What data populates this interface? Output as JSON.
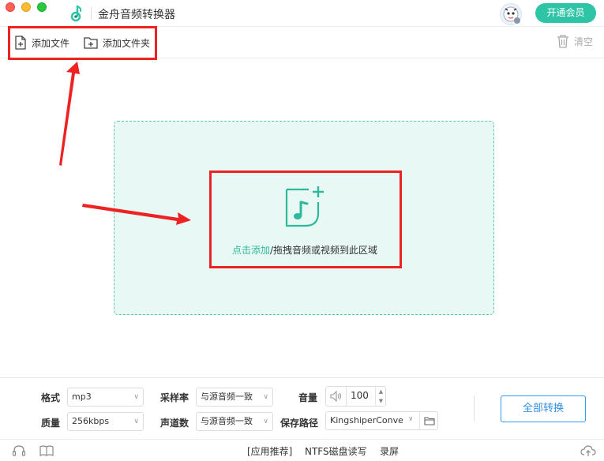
{
  "window": {
    "title": "金舟音频转换器"
  },
  "header": {
    "vip_label": "开通会员"
  },
  "toolbar": {
    "add_file": "添加文件",
    "add_folder": "添加文件夹",
    "clear": "清空"
  },
  "dropzone": {
    "link_text": "点击添加",
    "hint_text": "/拖拽音频或视频到此区域"
  },
  "settings": {
    "format_label": "格式",
    "format_value": "mp3",
    "quality_label": "质量",
    "quality_value": "256kbps",
    "samplerate_label": "采样率",
    "samplerate_value": "与源音频一致",
    "channels_label": "声道数",
    "channels_value": "与源音频一致",
    "volume_label": "音量",
    "volume_value": "100",
    "path_label": "保存路径",
    "path_value": "KingshiperConvert",
    "convert_all": "全部转换"
  },
  "footer": {
    "app_recommend": "[应用推荐]",
    "ntfs": "NTFS磁盘读写",
    "record": "录屏"
  },
  "colors": {
    "accent": "#2fc4a5",
    "convert_border": "#2f9df4",
    "annotation": "#ee2222",
    "drop_bg": "#e8f8f4"
  },
  "icons": [
    "app-logo-icon",
    "add-file-icon",
    "add-folder-icon",
    "trash-icon",
    "music-add-icon",
    "volume-icon",
    "folder-icon",
    "headset-icon",
    "book-icon",
    "cloud-upload-icon"
  ]
}
